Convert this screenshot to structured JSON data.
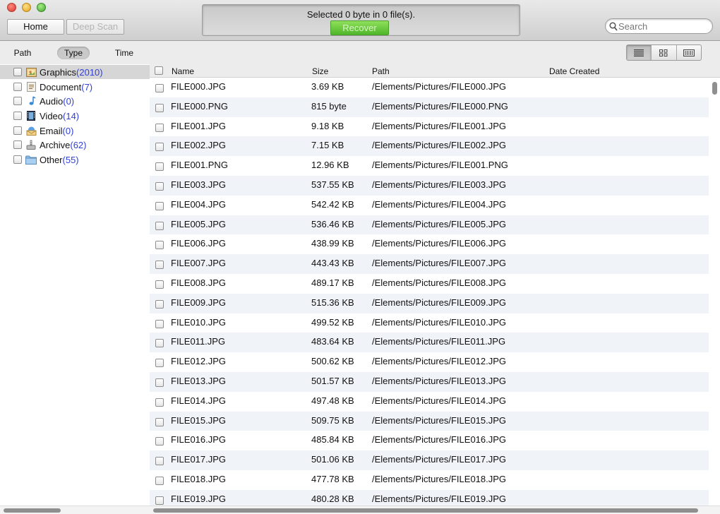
{
  "toolbar": {
    "home_label": "Home",
    "deep_scan_label": "Deep Scan",
    "status_text": "Selected 0 byte in 0 file(s).",
    "recover_label": "Recover",
    "search_placeholder": "Search",
    "accent_green": "#5cc232"
  },
  "view_tabs": [
    "Path",
    "Type",
    "Time"
  ],
  "selected_view_tab": "Type",
  "view_modes": [
    "list-view-icon",
    "grid-view-icon",
    "filmstrip-view-icon"
  ],
  "sidebar": {
    "items": [
      {
        "label": "Graphics",
        "count": "(2010)",
        "icon": "graphics-icon",
        "selected": true
      },
      {
        "label": "Document",
        "count": "(7)",
        "icon": "document-icon",
        "selected": false
      },
      {
        "label": "Audio",
        "count": "(0)",
        "icon": "audio-icon",
        "selected": false
      },
      {
        "label": "Video",
        "count": "(14)",
        "icon": "video-icon",
        "selected": false
      },
      {
        "label": "Email",
        "count": "(0)",
        "icon": "email-icon",
        "selected": false
      },
      {
        "label": "Archive",
        "count": "(62)",
        "icon": "archive-icon",
        "selected": false
      },
      {
        "label": "Other",
        "count": "(55)",
        "icon": "folder-icon",
        "selected": false
      }
    ],
    "count_color": "#2f3fd8"
  },
  "table": {
    "headers": {
      "name": "Name",
      "size": "Size",
      "path": "Path",
      "date": "Date Created"
    },
    "rows": [
      {
        "name": "FILE000.JPG",
        "size": "3.69 KB",
        "path": "/Elements/Pictures/FILE000.JPG"
      },
      {
        "name": "FILE000.PNG",
        "size": "815 byte",
        "path": "/Elements/Pictures/FILE000.PNG"
      },
      {
        "name": "FILE001.JPG",
        "size": "9.18 KB",
        "path": "/Elements/Pictures/FILE001.JPG"
      },
      {
        "name": "FILE002.JPG",
        "size": "7.15 KB",
        "path": "/Elements/Pictures/FILE002.JPG"
      },
      {
        "name": "FILE001.PNG",
        "size": "12.96 KB",
        "path": "/Elements/Pictures/FILE001.PNG"
      },
      {
        "name": "FILE003.JPG",
        "size": "537.55 KB",
        "path": "/Elements/Pictures/FILE003.JPG"
      },
      {
        "name": "FILE004.JPG",
        "size": "542.42 KB",
        "path": "/Elements/Pictures/FILE004.JPG"
      },
      {
        "name": "FILE005.JPG",
        "size": "536.46 KB",
        "path": "/Elements/Pictures/FILE005.JPG"
      },
      {
        "name": "FILE006.JPG",
        "size": "438.99 KB",
        "path": "/Elements/Pictures/FILE006.JPG"
      },
      {
        "name": "FILE007.JPG",
        "size": "443.43 KB",
        "path": "/Elements/Pictures/FILE007.JPG"
      },
      {
        "name": "FILE008.JPG",
        "size": "489.17 KB",
        "path": "/Elements/Pictures/FILE008.JPG"
      },
      {
        "name": "FILE009.JPG",
        "size": "515.36 KB",
        "path": "/Elements/Pictures/FILE009.JPG"
      },
      {
        "name": "FILE010.JPG",
        "size": "499.52 KB",
        "path": "/Elements/Pictures/FILE010.JPG"
      },
      {
        "name": "FILE011.JPG",
        "size": "483.64 KB",
        "path": "/Elements/Pictures/FILE011.JPG"
      },
      {
        "name": "FILE012.JPG",
        "size": "500.62 KB",
        "path": "/Elements/Pictures/FILE012.JPG"
      },
      {
        "name": "FILE013.JPG",
        "size": "501.57 KB",
        "path": "/Elements/Pictures/FILE013.JPG"
      },
      {
        "name": "FILE014.JPG",
        "size": "497.48 KB",
        "path": "/Elements/Pictures/FILE014.JPG"
      },
      {
        "name": "FILE015.JPG",
        "size": "509.75 KB",
        "path": "/Elements/Pictures/FILE015.JPG"
      },
      {
        "name": "FILE016.JPG",
        "size": "485.84 KB",
        "path": "/Elements/Pictures/FILE016.JPG"
      },
      {
        "name": "FILE017.JPG",
        "size": "501.06 KB",
        "path": "/Elements/Pictures/FILE017.JPG"
      },
      {
        "name": "FILE018.JPG",
        "size": "477.78 KB",
        "path": "/Elements/Pictures/FILE018.JPG"
      },
      {
        "name": "FILE019.JPG",
        "size": "480.28 KB",
        "path": "/Elements/Pictures/FILE019.JPG"
      }
    ]
  }
}
